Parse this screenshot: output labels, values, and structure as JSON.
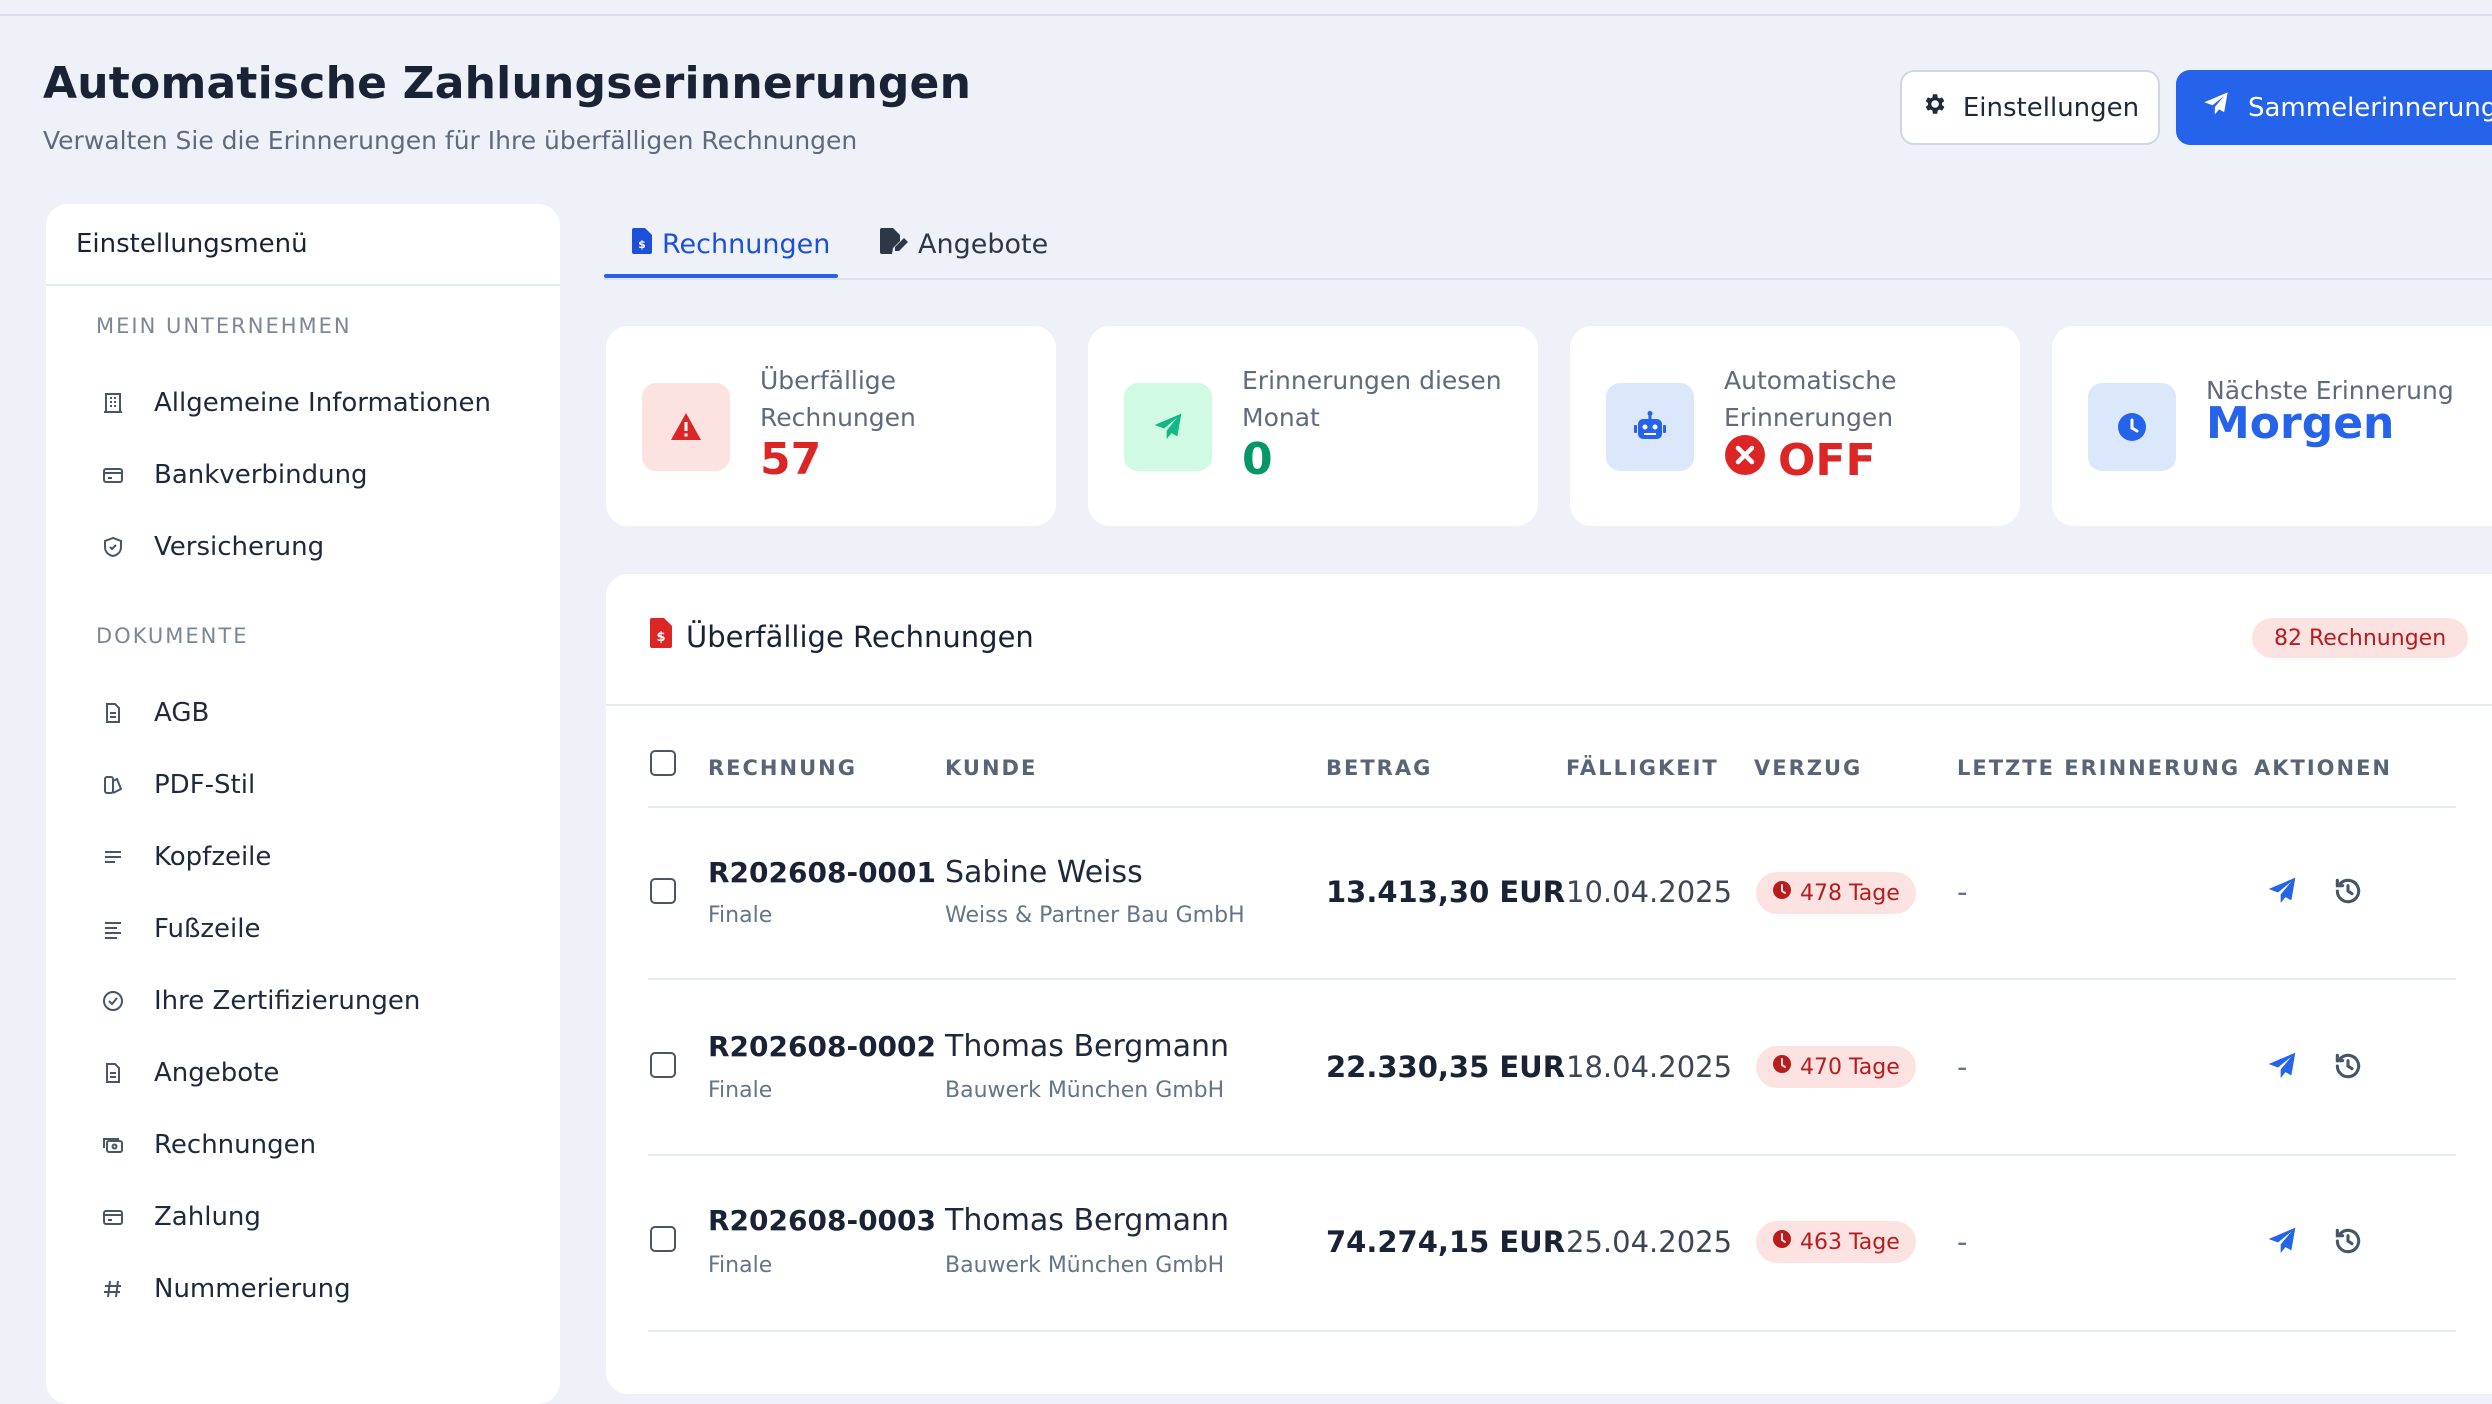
{
  "header": {
    "title": "Automatische Zahlungserinnerungen",
    "subtitle": "Verwalten Sie die Erinnerungen für Ihre überfälligen Rechnungen",
    "settings_label": "Einstellungen",
    "bulk_label": "Sammelerinnerung"
  },
  "sidebar": {
    "title": "Einstellungsmenü",
    "sections": [
      {
        "label": "MEIN UNTERNEHMEN",
        "items": [
          "Allgemeine Informationen",
          "Bankverbindung",
          "Versicherung"
        ]
      },
      {
        "label": "DOKUMENTE",
        "items": [
          "AGB",
          "PDF-Stil",
          "Kopfzeile",
          "Fußzeile",
          "Ihre Zertifizierungen",
          "Angebote",
          "Rechnungen",
          "Zahlung",
          "Nummerierung"
        ]
      }
    ]
  },
  "tabs": [
    {
      "label": "Rechnungen",
      "active": true
    },
    {
      "label": "Angebote",
      "active": false
    }
  ],
  "stats": [
    {
      "label": "Überfällige Rechnungen",
      "value": "57",
      "icon": "warning-icon",
      "color": "#dc2626"
    },
    {
      "label": "Erinnerungen diesen Monat",
      "value": "0",
      "icon": "paper-plane-icon",
      "color": "#059669"
    },
    {
      "label": "Automatische Erinnerungen",
      "value": "OFF",
      "icon": "robot-icon",
      "color": "#dc2626"
    },
    {
      "label": "Nächste Erinnerung",
      "value": "Morgen",
      "icon": "clock-icon",
      "color": "#2563eb"
    }
  ],
  "table": {
    "title": "Überfällige Rechnungen",
    "count": "82 Rechnungen",
    "columns": [
      "RECHNUNG",
      "KUNDE",
      "BETRAG",
      "FÄLLIGKEIT",
      "VERZUG",
      "LETZTE ERINNERUNG",
      "AKTIONEN"
    ],
    "rows": [
      {
        "number": "R202608-0001",
        "status": "Finale",
        "customer": "Sabine Weiss",
        "company": "Weiss & Partner Bau GmbH",
        "amount": "13.413,30 EUR",
        "due": "10.04.2025",
        "delay": "478 Tage",
        "last": "-"
      },
      {
        "number": "R202608-0002",
        "status": "Finale",
        "customer": "Thomas Bergmann",
        "company": "Bauwerk München GmbH",
        "amount": "22.330,35 EUR",
        "due": "18.04.2025",
        "delay": "470 Tage",
        "last": "-"
      },
      {
        "number": "R202608-0003",
        "status": "Finale",
        "customer": "Thomas Bergmann",
        "company": "Bauwerk München GmbH",
        "amount": "74.274,15 EUR",
        "due": "25.04.2025",
        "delay": "463 Tage",
        "last": "-"
      }
    ]
  },
  "colors": {
    "primary": "#2563eb",
    "danger": "#dc2626",
    "success": "#059669",
    "background": "#eef2f8"
  }
}
